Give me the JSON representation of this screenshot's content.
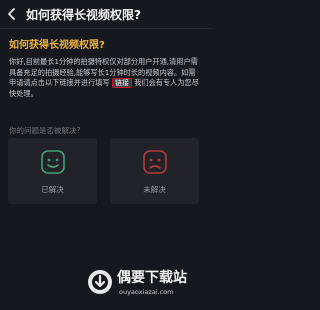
{
  "nav": {
    "back_icon": "chevron-left-icon",
    "title": "如何获得长视频权限?"
  },
  "question": {
    "title": "如何获得长视频权限?",
    "body_before": "你好,目前最长1分钟的拍摄特权仅对部分用户开通,清用户需具备充足的拍摄经验,能够写长1分钟时长的视频内容。如需申请请点击以下链接并进行填写",
    "link": "链接",
    "body_after": "我们会有专人为您尽快处理。"
  },
  "feedback": {
    "question": "你的问题是否被解决?",
    "resolved_label": "已解决",
    "unresolved_label": "未解决",
    "resolved_icon": "smile-face-icon",
    "unresolved_icon": "sad-face-icon",
    "resolved_color": "#3f9e78",
    "unresolved_color": "#b83a3a"
  },
  "watermark": {
    "title": "偶要下载站",
    "url": "ouyaoxiazai.com"
  },
  "colors": {
    "background": "#17181e",
    "accent": "#e9b23a",
    "card": "#222329",
    "link_border": "#d2102b"
  }
}
